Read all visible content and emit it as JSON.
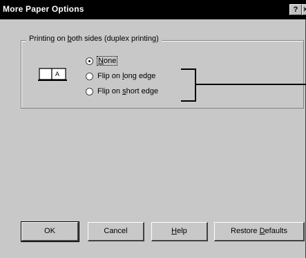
{
  "window": {
    "title": "More Paper Options",
    "help_glyph": "?",
    "close_glyph": "×"
  },
  "duplex": {
    "group_label_pre": "Printing on ",
    "group_label_accel": "b",
    "group_label_post": "oth sides (duplex printing)",
    "options": [
      {
        "pre": "",
        "accel": "N",
        "post": "one",
        "checked": true
      },
      {
        "pre": "Flip on ",
        "accel": "l",
        "post": "ong edge",
        "checked": false
      },
      {
        "pre": "Flip on ",
        "accel": "s",
        "post": "hort edge",
        "checked": false
      }
    ],
    "icon_letter": "A"
  },
  "buttons": {
    "ok": "OK",
    "cancel": "Cancel",
    "help_accel": "H",
    "help_post": "elp",
    "restore_pre": "Restore ",
    "restore_accel": "D",
    "restore_post": "efaults"
  }
}
